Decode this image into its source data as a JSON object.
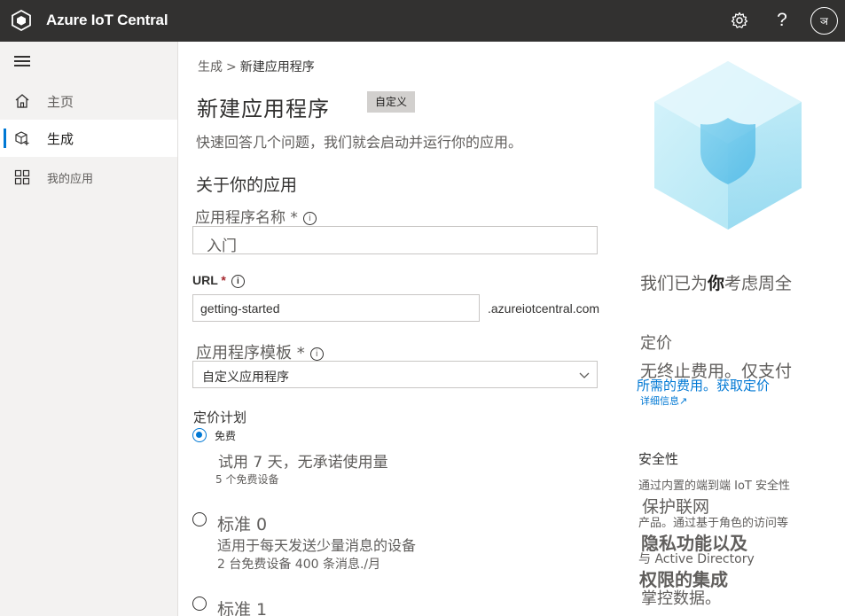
{
  "topbar": {
    "app_title": "Azure IoT Central",
    "help_label": "?",
    "avatar_initial": "ञ"
  },
  "sidebar": {
    "items": [
      {
        "label": "主页",
        "icon": "home-icon"
      },
      {
        "label": "生成",
        "icon": "build-icon",
        "active": true
      },
      {
        "label": "我的应用",
        "icon": "apps-icon"
      }
    ]
  },
  "breadcrumb": {
    "parent": "生成",
    "separator": ">",
    "current": "新建应用程序"
  },
  "page": {
    "title": "新建应用程序",
    "badge": "自定义",
    "subtitle": "快速回答几个问题，我们就会启动并运行你的应用。",
    "section_title": "关于你的应用"
  },
  "form": {
    "app_name_label": "应用程序名称 *",
    "app_name_value": "入门",
    "url_label": "URL",
    "url_required": "*",
    "url_value": "getting-started",
    "url_suffix": ".azureiotcentral.com",
    "template_label": "应用程序模板 *",
    "template_value": "自定义应用程序",
    "pricing_label": "定价计划",
    "plans": [
      {
        "label": "免费",
        "desc": "试用 7 天，无承诺使用量",
        "sub": "5 个免费设备",
        "selected": true
      },
      {
        "label": "标准 0",
        "desc": "适用于每天发送少量消息的设备",
        "sub": "2 台免费设备 400 条消息./月",
        "selected": false
      },
      {
        "label": "标准 1",
        "selected": false
      }
    ]
  },
  "right_panel": {
    "heading_pre": "我们已为",
    "heading_bold": "你",
    "heading_post": "考虑周全",
    "pricing_title": "定价",
    "pricing_line1": "无终止费用。仅支付",
    "pricing_line2": "所需的费用。获取定价",
    "pricing_link": "详细信息",
    "security_title": "安全性",
    "security_line1": "通过内置的端到端 IoT 安全性",
    "security_line2": "保护联网",
    "security_line3": "产品。通过基于角色的访问等",
    "security_line4": "隐私功能以及",
    "security_line5": "与 Active Directory",
    "security_line6": "权限的集成",
    "security_line7": "掌控数据。"
  },
  "colors": {
    "accent": "#0078d4",
    "topbar": "#323130",
    "sidebar": "#f3f2f1"
  }
}
